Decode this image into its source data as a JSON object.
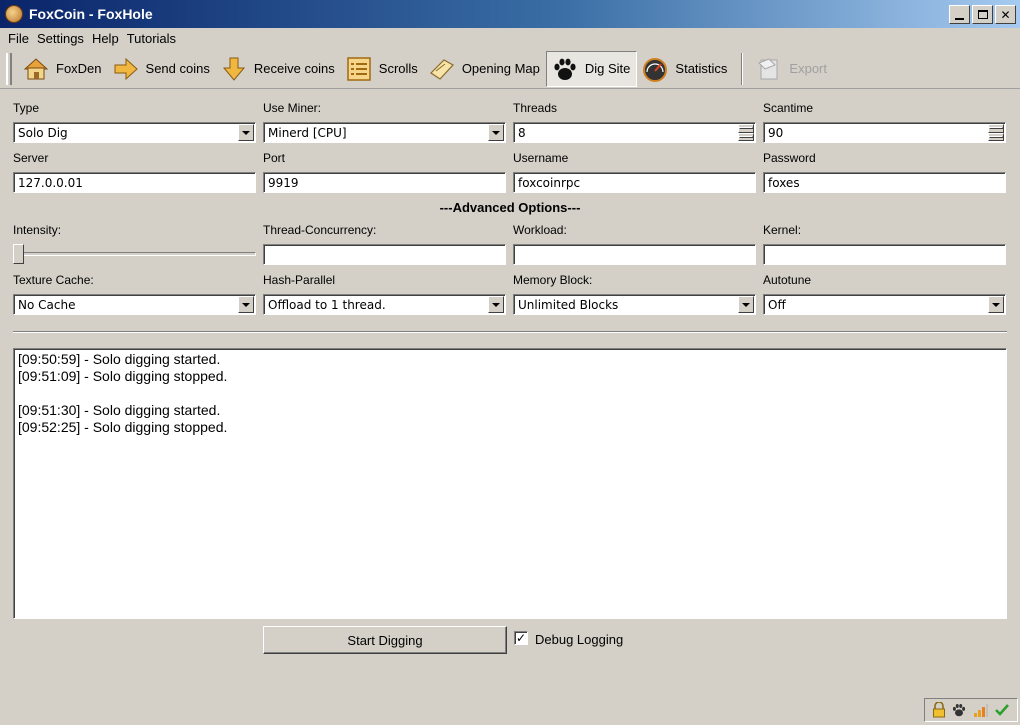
{
  "window": {
    "title": "FoxCoin - FoxHole"
  },
  "menu": [
    "File",
    "Settings",
    "Help",
    "Tutorials"
  ],
  "toolbar": {
    "foxden": "FoxDen",
    "send": "Send coins",
    "receive": "Receive coins",
    "scrolls": "Scrolls",
    "map": "Opening Map",
    "dig": "Dig Site",
    "stats": "Statistics",
    "export": "Export"
  },
  "form": {
    "type_label": "Type",
    "type_value": "Solo Dig",
    "miner_label": "Use Miner:",
    "miner_value": "Minerd [CPU]",
    "threads_label": "Threads",
    "threads_value": "8",
    "scantime_label": "Scantime",
    "scantime_value": "90",
    "server_label": "Server",
    "server_value": "127.0.0.01",
    "port_label": "Port",
    "port_value": "9919",
    "username_label": "Username",
    "username_value": "foxcoinrpc",
    "password_label": "Password",
    "password_value": "foxes",
    "advanced_heading": "---Advanced Options---",
    "intensity_label": "Intensity:",
    "intensity_level": 0,
    "thread_concurrency_label": "Thread-Concurrency:",
    "thread_concurrency_value": "",
    "workload_label": "Workload:",
    "workload_value": "",
    "kernel_label": "Kernel:",
    "kernel_value": "",
    "texture_cache_label": "Texture Cache:",
    "texture_cache_value": "No Cache",
    "hash_parallel_label": "Hash-Parallel",
    "hash_parallel_value": "Offload to 1 thread.",
    "memory_block_label": "Memory Block:",
    "memory_block_value": "Unlimited Blocks",
    "autotune_label": "Autotune",
    "autotune_value": "Off"
  },
  "log": [
    "[09:50:59] - Solo digging started.",
    "[09:51:09] - Solo digging stopped.",
    "",
    "[09:51:30] - Solo digging started.",
    "[09:52:25] - Solo digging stopped."
  ],
  "controls": {
    "start_button": "Start Digging",
    "debug_label": "Debug Logging",
    "debug_checked": true
  },
  "status_icons": [
    "lock-icon",
    "paw-icon",
    "signal-icon",
    "check-icon"
  ]
}
